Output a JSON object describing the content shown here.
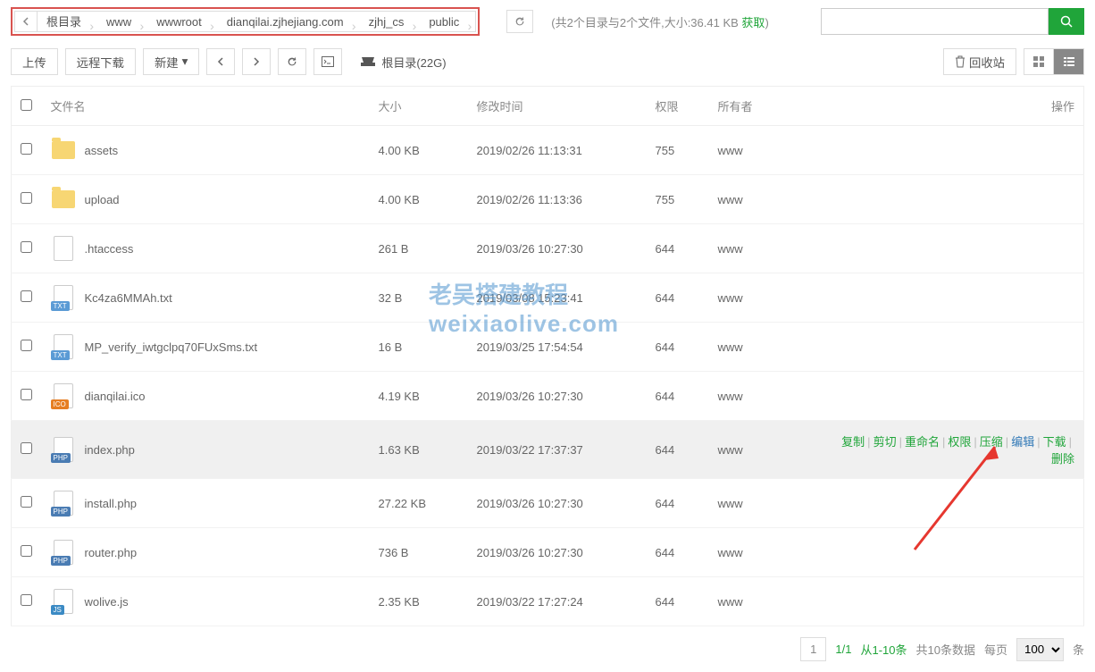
{
  "breadcrumb": [
    "根目录",
    "www",
    "wwwroot",
    "dianqilai.zjhejiang.com",
    "zjhj_cs",
    "public"
  ],
  "summary": {
    "prefix": "(共2个目录与2个文件,大小:36.41 KB ",
    "acquire": "获取",
    "suffix": ")"
  },
  "search": {
    "placeholder": ""
  },
  "toolbar": {
    "upload": "上传",
    "remote": "远程下载",
    "create": "新建",
    "disk_label": "根目录(22G)",
    "recycle": "回收站"
  },
  "columns": {
    "name": "文件名",
    "size": "大小",
    "mtime": "修改时间",
    "perm": "权限",
    "owner": "所有者",
    "op": "操作"
  },
  "files": [
    {
      "type": "folder",
      "name": "assets",
      "size": "4.00 KB",
      "mtime": "2019/02/26 11:13:31",
      "perm": "755",
      "owner": "www"
    },
    {
      "type": "folder",
      "name": "upload",
      "size": "4.00 KB",
      "mtime": "2019/02/26 11:13:36",
      "perm": "755",
      "owner": "www"
    },
    {
      "type": "file",
      "ext": "none",
      "name": ".htaccess",
      "size": "261 B",
      "mtime": "2019/03/26 10:27:30",
      "perm": "644",
      "owner": "www"
    },
    {
      "type": "file",
      "ext": "txt",
      "badge": "TXT",
      "name": "Kc4za6MMAh.txt",
      "size": "32 B",
      "mtime": "2019/03/08 15:23:41",
      "perm": "644",
      "owner": "www"
    },
    {
      "type": "file",
      "ext": "txt",
      "badge": "TXT",
      "name": "MP_verify_iwtgclpq70FUxSms.txt",
      "size": "16 B",
      "mtime": "2019/03/25 17:54:54",
      "perm": "644",
      "owner": "www"
    },
    {
      "type": "file",
      "ext": "ico",
      "badge": "ICO",
      "name": "dianqilai.ico",
      "size": "4.19 KB",
      "mtime": "2019/03/26 10:27:30",
      "perm": "644",
      "owner": "www"
    },
    {
      "type": "file",
      "ext": "php",
      "badge": "PHP",
      "name": "index.php",
      "size": "1.63 KB",
      "mtime": "2019/03/22 17:37:37",
      "perm": "644",
      "owner": "www",
      "highlight": true
    },
    {
      "type": "file",
      "ext": "php",
      "badge": "PHP",
      "name": "install.php",
      "size": "27.22 KB",
      "mtime": "2019/03/26 10:27:30",
      "perm": "644",
      "owner": "www"
    },
    {
      "type": "file",
      "ext": "php",
      "badge": "PHP",
      "name": "router.php",
      "size": "736 B",
      "mtime": "2019/03/26 10:27:30",
      "perm": "644",
      "owner": "www"
    },
    {
      "type": "file",
      "ext": "js",
      "badge": "JS",
      "name": "wolive.js",
      "size": "2.35 KB",
      "mtime": "2019/03/22 17:27:24",
      "perm": "644",
      "owner": "www"
    }
  ],
  "row_actions": {
    "copy": "复制",
    "cut": "剪切",
    "rename": "重命名",
    "perm": "权限",
    "zip": "压缩",
    "edit": "编辑",
    "download": "下载",
    "delete": "删除"
  },
  "pager": {
    "page": "1",
    "total_pages": "1/1",
    "range": "从1-10条",
    "total": "共10条数据",
    "per_label_pre": "每页",
    "per_value": "100",
    "per_label_suf": "条"
  },
  "watermark": {
    "line1": "老吴搭建教程",
    "line2": "weixiaolive.com"
  }
}
